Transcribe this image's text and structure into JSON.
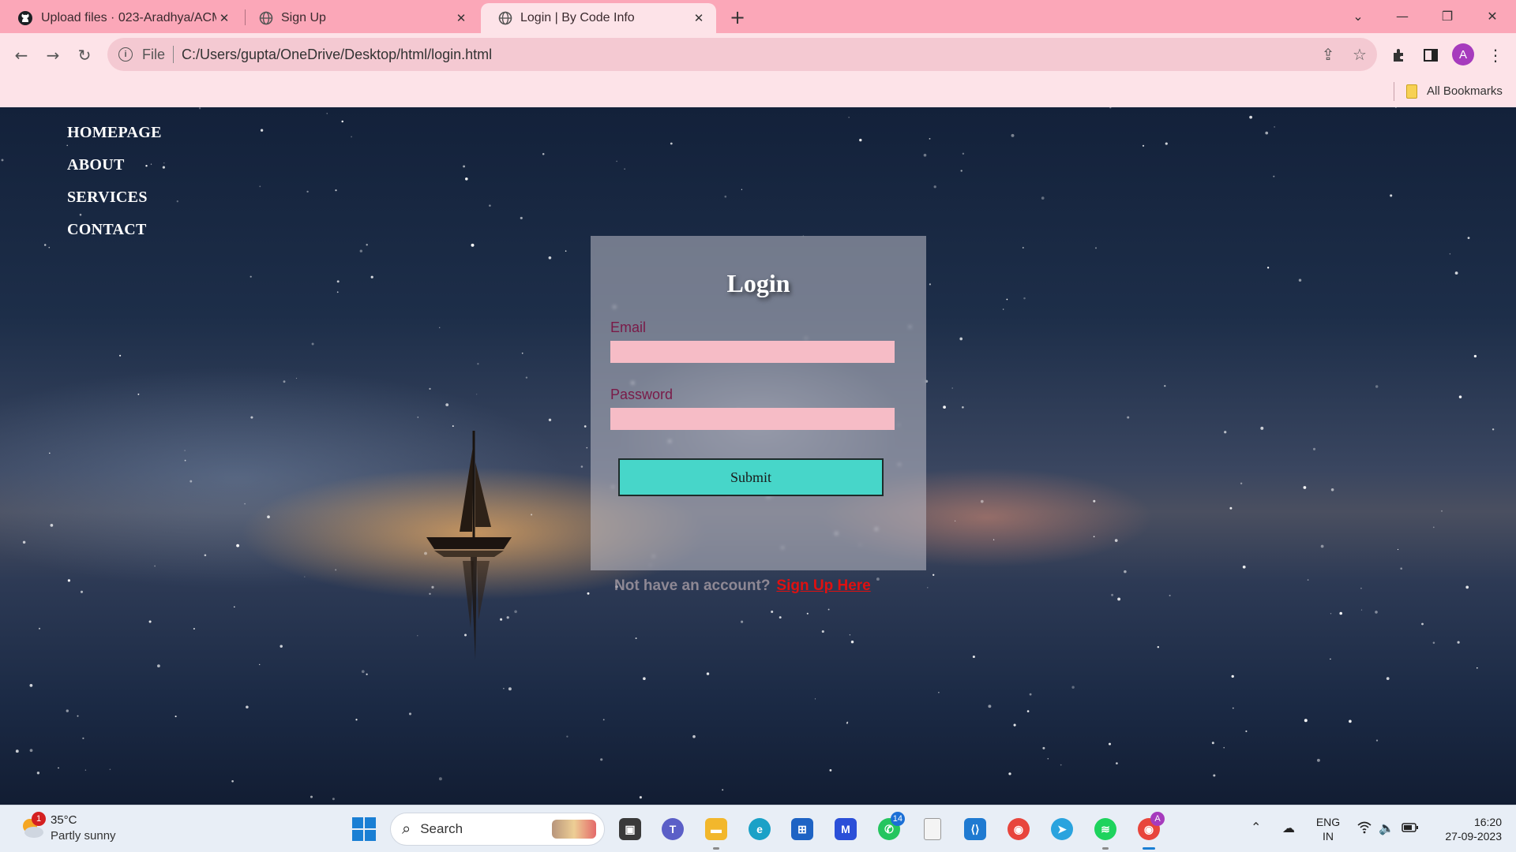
{
  "browser": {
    "tabs": [
      {
        "title": "Upload files · 023-Aradhya/ACM",
        "icon": "github-icon"
      },
      {
        "title": "Sign Up",
        "icon": "globe-icon"
      },
      {
        "title": "Login | By Code Info",
        "icon": "globe-icon",
        "active": true
      }
    ],
    "address": {
      "scheme_label": "File",
      "url": "C:/Users/gupta/OneDrive/Desktop/html/login.html"
    },
    "profile_initial": "A",
    "bookmarks": {
      "all_label": "All Bookmarks"
    }
  },
  "page": {
    "nav": [
      "HOMEPAGE",
      "ABOUT",
      "SERVICES",
      "CONTACT"
    ],
    "login": {
      "title": "Login",
      "email_label": "Email",
      "email_value": "",
      "password_label": "Password",
      "password_value": "",
      "submit_label": "Submit"
    },
    "signup_prompt": "Not have an account?",
    "signup_link": "Sign Up Here"
  },
  "taskbar": {
    "weather": {
      "badge": "1",
      "temp": "35°C",
      "desc": "Partly sunny"
    },
    "search_placeholder": "Search",
    "apps": [
      {
        "name": "task-view",
        "label": ""
      },
      {
        "name": "teams",
        "label": ""
      },
      {
        "name": "file-explorer",
        "label": ""
      },
      {
        "name": "edge",
        "label": ""
      },
      {
        "name": "store",
        "label": ""
      },
      {
        "name": "m365",
        "label": ""
      },
      {
        "name": "whatsapp",
        "label": "",
        "badge": "14"
      },
      {
        "name": "notepad",
        "label": ""
      },
      {
        "name": "vscode",
        "label": ""
      },
      {
        "name": "chrome",
        "label": ""
      },
      {
        "name": "telegram",
        "label": ""
      },
      {
        "name": "spotify",
        "label": ""
      },
      {
        "name": "chrome-profile",
        "label": "",
        "badge": "A"
      }
    ],
    "lang_line1": "ENG",
    "lang_line2": "IN",
    "time": "16:20",
    "date": "27-09-2023"
  },
  "colors": {
    "tab_bar": "#fba7b8",
    "toolbar": "#fde3e8",
    "omnibox": "#f4c9d2",
    "input_bg": "#f6bcc6",
    "submit_bg": "#47d6c9",
    "signup_link": "#e01010",
    "label_color": "#7a1a48"
  }
}
